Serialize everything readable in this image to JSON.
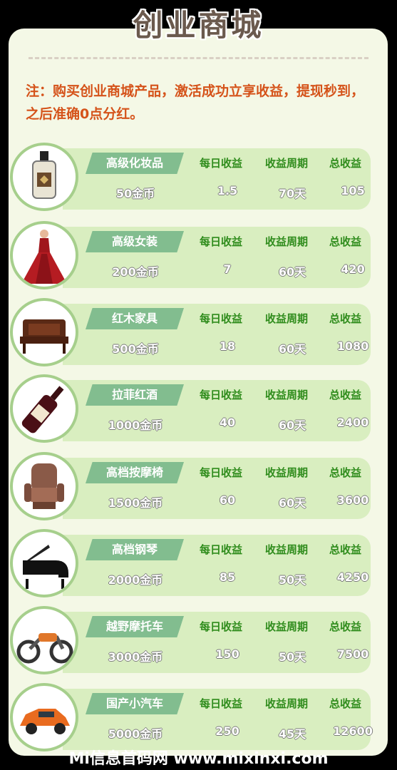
{
  "page": {
    "title": "创业商城",
    "note": "注：购买创业商城产品，激活成功立享收益，提现秒到，之后准确0点分红。",
    "watermark": "Mi信息首码网 www.mixinxi.com"
  },
  "headers": {
    "daily": "每日收益",
    "period": "收益周期",
    "total": "总收益"
  },
  "products": [
    {
      "name": "高级化妆品",
      "price": "50金币",
      "daily": "1.5",
      "period": "70天",
      "total": "105",
      "icon": "perfume-bottle-icon"
    },
    {
      "name": "高级女装",
      "price": "200金币",
      "daily": "7",
      "period": "60天",
      "total": "420",
      "icon": "red-dress-icon"
    },
    {
      "name": "红木家具",
      "price": "500金币",
      "daily": "18",
      "period": "60天",
      "total": "1080",
      "icon": "rosewood-sofa-icon"
    },
    {
      "name": "拉菲红酒",
      "price": "1000金币",
      "daily": "40",
      "period": "60天",
      "total": "2400",
      "icon": "wine-bottle-icon"
    },
    {
      "name": "高档按摩椅",
      "price": "1500金币",
      "daily": "60",
      "period": "60天",
      "total": "3600",
      "icon": "massage-chair-icon"
    },
    {
      "name": "高档钢琴",
      "price": "2000金币",
      "daily": "85",
      "period": "50天",
      "total": "4250",
      "icon": "grand-piano-icon"
    },
    {
      "name": "越野摩托车",
      "price": "3000金币",
      "daily": "150",
      "period": "50天",
      "total": "7500",
      "icon": "motorcycle-icon"
    },
    {
      "name": "国产小汽车",
      "price": "5000金币",
      "daily": "250",
      "period": "45天",
      "total": "12600",
      "icon": "orange-car-icon"
    }
  ]
}
